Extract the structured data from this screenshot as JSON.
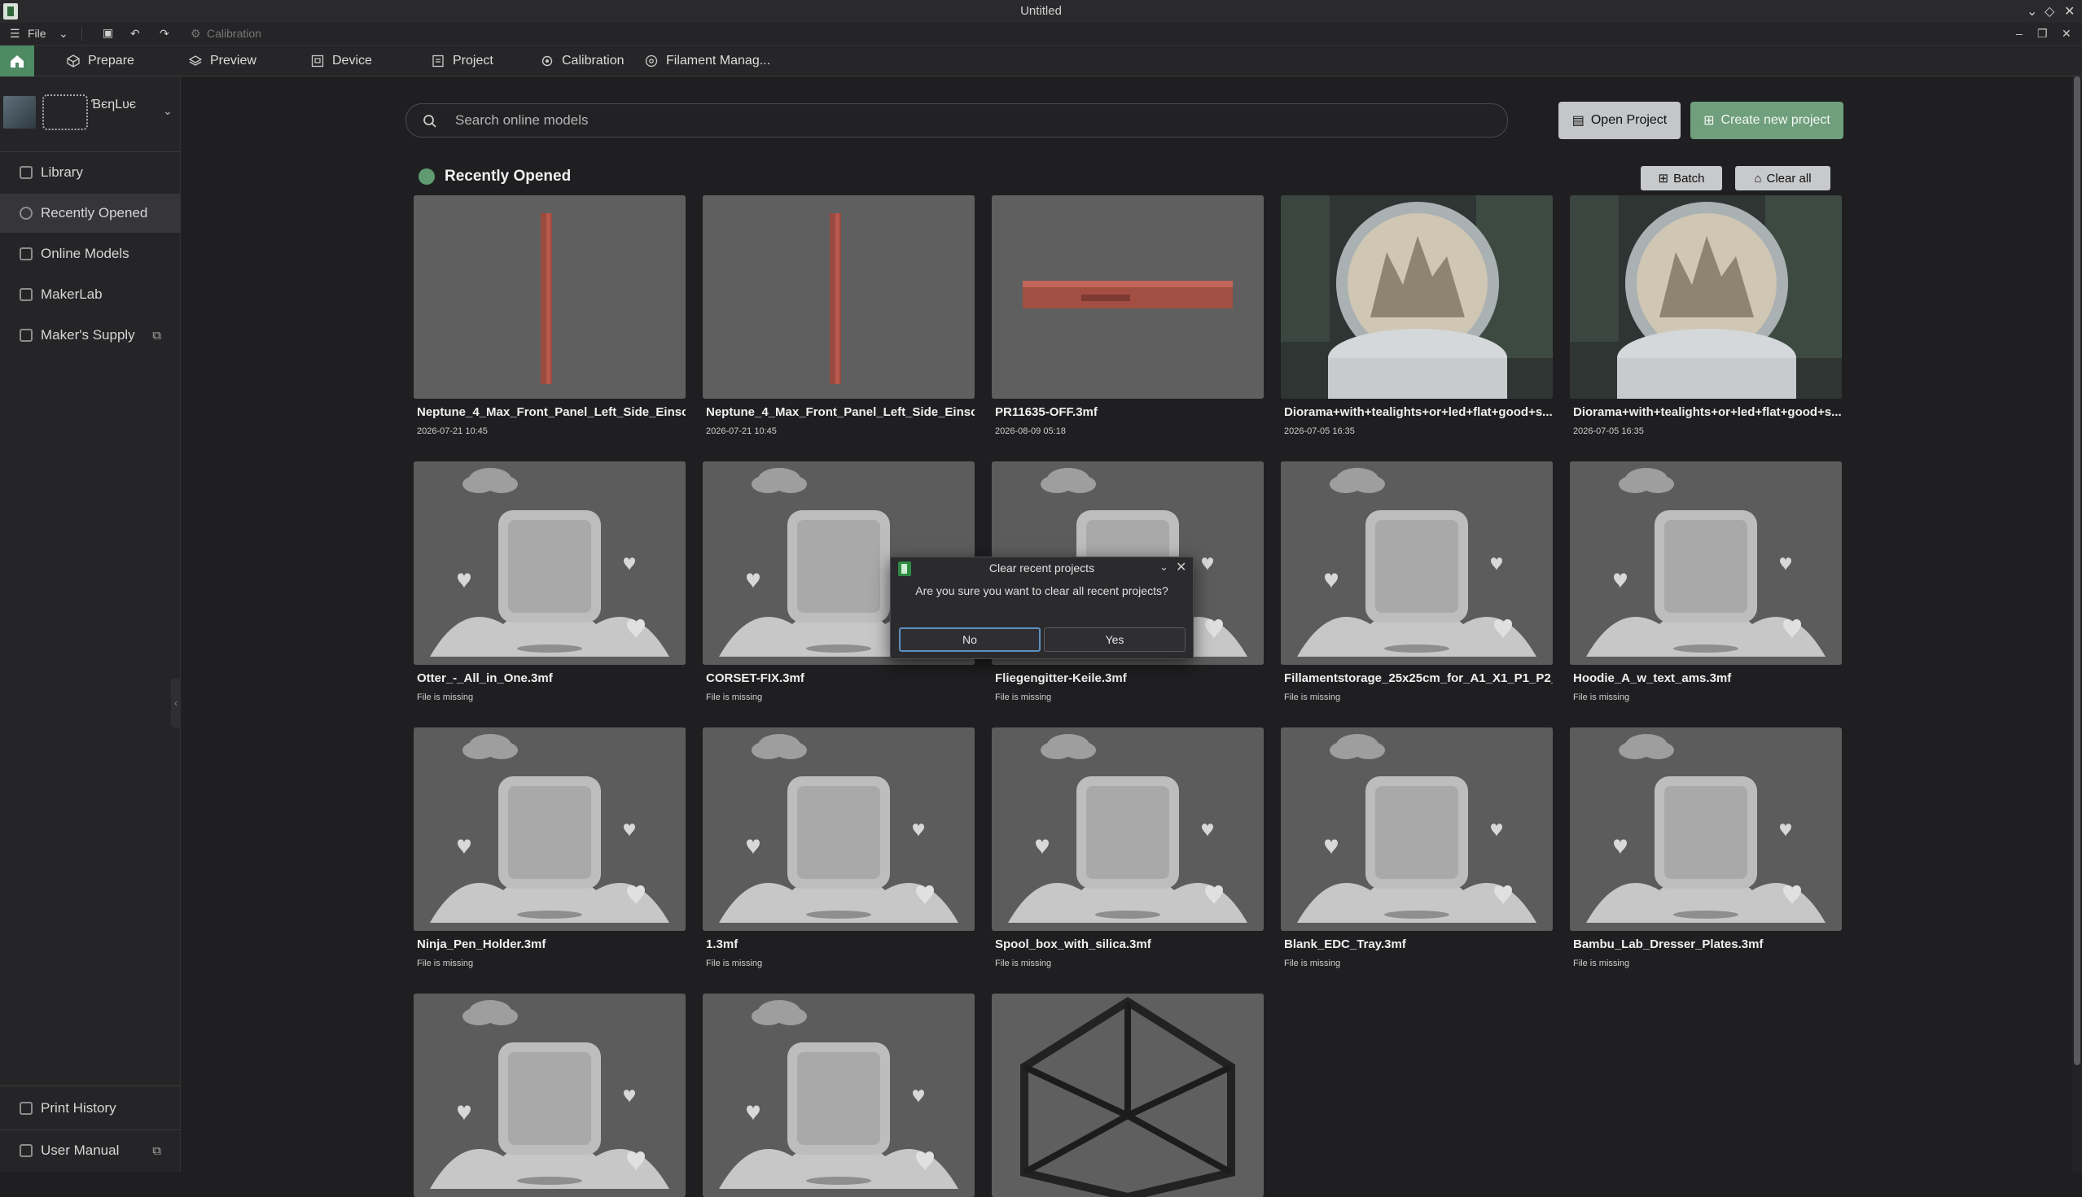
{
  "window": {
    "title": "Untitled"
  },
  "menubar": {
    "file_label": "File",
    "calibration_label": "Calibration"
  },
  "tabs": [
    {
      "label": "Prepare",
      "icon": "cube-icon"
    },
    {
      "label": "Preview",
      "icon": "layers-icon"
    },
    {
      "label": "Device",
      "icon": "device-icon"
    },
    {
      "label": "Project",
      "icon": "project-icon"
    },
    {
      "label": "Calibration",
      "icon": "calibration-icon"
    },
    {
      "label": "Filament Manag...",
      "icon": "filament-icon"
    }
  ],
  "sidebar": {
    "username": "ƁєηLυє",
    "items": [
      {
        "label": "Library",
        "icon": "home-outline-icon"
      },
      {
        "label": "Recently Opened",
        "icon": "clock-icon",
        "active": true
      },
      {
        "label": "Online Models",
        "icon": "grid-icon"
      },
      {
        "label": "MakerLab",
        "icon": "makerlab-icon"
      },
      {
        "label": "Maker's Supply",
        "icon": "supply-icon",
        "external": true
      }
    ],
    "bottom_items": [
      {
        "label": "Print History",
        "icon": "history-icon"
      },
      {
        "label": "User Manual",
        "icon": "manual-icon",
        "external": true
      }
    ]
  },
  "search": {
    "placeholder": "Search online models",
    "value": ""
  },
  "actions": {
    "open_project": "Open Project",
    "create_project": "Create new project"
  },
  "section": {
    "title": "Recently Opened",
    "batch_label": "Batch",
    "clear_all_label": "Clear all"
  },
  "projects": [
    {
      "name": "Neptune_4_Max_Front_Panel_Left_Side_Einsc...",
      "meta": "2026-07-21 10:45",
      "thumb": "panel-vertical"
    },
    {
      "name": "Neptune_4_Max_Front_Panel_Left_Side_Einsc...",
      "meta": "2026-07-21 10:45",
      "thumb": "panel-vertical"
    },
    {
      "name": "PR11635-OFF.3mf",
      "meta": "2026-08-09 05:18",
      "thumb": "panel-horizontal"
    },
    {
      "name": "Diorama+with+tealights+or+led+flat+good+s...",
      "meta": "2026-07-05 16:35",
      "thumb": "snowglobe"
    },
    {
      "name": "Diorama+with+tealights+or+led+flat+good+s...",
      "meta": "2026-07-05 16:35",
      "thumb": "snowglobe"
    },
    {
      "name": "Otter_-_All_in_One.3mf",
      "meta": "File is missing",
      "thumb": "placeholder"
    },
    {
      "name": "CORSET-FIX.3mf",
      "meta": "File is missing",
      "thumb": "placeholder"
    },
    {
      "name": "Fliegengitter-Keile.3mf",
      "meta": "File is missing",
      "thumb": "placeholder"
    },
    {
      "name": "Fillamentstorage_25x25cm_for_A1_X1_P1_P2_...",
      "meta": "File is missing",
      "thumb": "placeholder"
    },
    {
      "name": "Hoodie_A_w_text_ams.3mf",
      "meta": "File is missing",
      "thumb": "placeholder"
    },
    {
      "name": "Ninja_Pen_Holder.3mf",
      "meta": "File is missing",
      "thumb": "placeholder"
    },
    {
      "name": "1.3mf",
      "meta": "File is missing",
      "thumb": "placeholder"
    },
    {
      "name": "Spool_box_with_silica.3mf",
      "meta": "File is missing",
      "thumb": "placeholder"
    },
    {
      "name": "Blank_EDC_Tray.3mf",
      "meta": "File is missing",
      "thumb": "placeholder"
    },
    {
      "name": "Bambu_Lab_Dresser_Plates.3mf",
      "meta": "File is missing",
      "thumb": "placeholder"
    },
    {
      "name": "",
      "meta": "",
      "thumb": "placeholder"
    },
    {
      "name": "",
      "meta": "",
      "thumb": "placeholder"
    },
    {
      "name": "",
      "meta": "",
      "thumb": "frame"
    }
  ],
  "dialog": {
    "title": "Clear recent projects",
    "message": "Are you sure you want to clear all recent projects?",
    "no_label": "No",
    "yes_label": "Yes"
  },
  "colors": {
    "accent": "#4e8a62",
    "create_button": "#6f9f7c",
    "dialog_focus": "#5d8fbf"
  }
}
